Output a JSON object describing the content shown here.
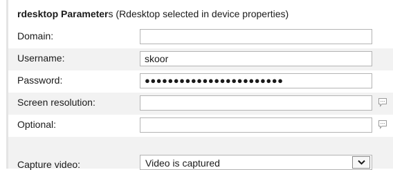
{
  "section": {
    "title_bold": "rdesktop Parameter",
    "title_rest": "s (Rdesktop selected in device properties)"
  },
  "fields": {
    "domain": {
      "label": "Domain:",
      "value": ""
    },
    "username": {
      "label": "Username:",
      "value": "skoor"
    },
    "password": {
      "label": "Password:",
      "value": "●●●●●●●●●●●●●●●●●●●●●●●●"
    },
    "screen_resolution": {
      "label": "Screen resolution:",
      "value": ""
    },
    "optional": {
      "label": "Optional:",
      "value": ""
    },
    "capture_video": {
      "label": "Capture video:",
      "selected": "Video is captured"
    }
  },
  "icons": {
    "comment": "comment-icon",
    "dropdown": "chevron-down-icon"
  },
  "colors": {
    "row_shade": "#f2f2f2",
    "field_border": "#b3b3b3",
    "icon_color": "#9a9a9a"
  }
}
